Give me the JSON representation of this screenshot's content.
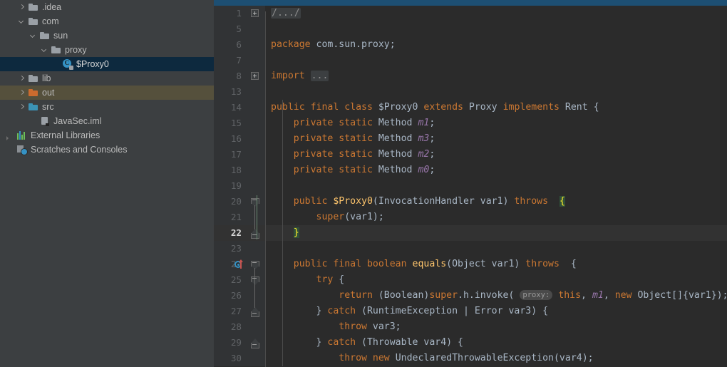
{
  "app": {
    "theme": "darcula",
    "accent_selection": "#0d293e",
    "excluded_bg": "#55503c",
    "topbar_color": "#1d4f73"
  },
  "sidebar": {
    "name": "Project tree",
    "items": [
      {
        "label": ".idea",
        "indent": 1,
        "twisty": "right",
        "icon": "folder-grey-icon",
        "state": "normal"
      },
      {
        "label": "com",
        "indent": 1,
        "twisty": "down",
        "icon": "folder-grey-icon",
        "state": "normal"
      },
      {
        "label": "sun",
        "indent": 2,
        "twisty": "down",
        "icon": "folder-grey-icon",
        "state": "normal"
      },
      {
        "label": "proxy",
        "indent": 3,
        "twisty": "down",
        "icon": "folder-grey-icon",
        "state": "normal"
      },
      {
        "label": "$Proxy0",
        "indent": 4,
        "twisty": "none",
        "icon": "java-class-icon",
        "state": "selected"
      },
      {
        "label": "lib",
        "indent": 1,
        "twisty": "right",
        "icon": "folder-grey-icon",
        "state": "normal"
      },
      {
        "label": "out",
        "indent": 1,
        "twisty": "right",
        "icon": "folder-orange-icon",
        "state": "excluded"
      },
      {
        "label": "src",
        "indent": 1,
        "twisty": "right",
        "icon": "folder-blue-icon",
        "state": "normal"
      },
      {
        "label": "JavaSec.iml",
        "indent": 2,
        "twisty": "none",
        "icon": "iml-file-icon",
        "state": "normal"
      },
      {
        "label": "External Libraries",
        "indent": 0,
        "twisty": "ext",
        "icon": "libraries-icon",
        "state": "normal"
      },
      {
        "label": "Scratches and Consoles",
        "indent": 0,
        "twisty": "none",
        "icon": "scratches-icon",
        "state": "normal"
      }
    ]
  },
  "editor": {
    "name": "code-editor",
    "current_line": 22,
    "lines": [
      {
        "num": "1",
        "fold": "plus-top",
        "rail": false,
        "tokens": [
          {
            "t": "/.../",
            "c": "fold"
          }
        ]
      },
      {
        "num": "5",
        "tokens": []
      },
      {
        "num": "6",
        "tokens": [
          {
            "t": "package ",
            "c": "kw"
          },
          {
            "t": "com.sun.proxy;",
            "c": "txt"
          }
        ]
      },
      {
        "num": "7",
        "tokens": []
      },
      {
        "num": "8",
        "fold": "plus",
        "tokens": [
          {
            "t": "import ",
            "c": "kw"
          },
          {
            "t": "...",
            "c": "fold"
          }
        ]
      },
      {
        "num": "13",
        "tokens": []
      },
      {
        "num": "14",
        "tokens": [
          {
            "t": "public final class ",
            "c": "kw"
          },
          {
            "t": "$Proxy0 ",
            "c": "txt"
          },
          {
            "t": "extends ",
            "c": "kw"
          },
          {
            "t": "Proxy ",
            "c": "txt"
          },
          {
            "t": "implements ",
            "c": "kw"
          },
          {
            "t": "Rent {",
            "c": "txt"
          }
        ]
      },
      {
        "num": "15",
        "tokens": [
          {
            "t": "    private static ",
            "c": "kw"
          },
          {
            "t": "Method ",
            "c": "txt"
          },
          {
            "t": "m1",
            "c": "fld"
          },
          {
            "t": ";",
            "c": "txt"
          }
        ]
      },
      {
        "num": "16",
        "tokens": [
          {
            "t": "    private static ",
            "c": "kw"
          },
          {
            "t": "Method ",
            "c": "txt"
          },
          {
            "t": "m3",
            "c": "fld"
          },
          {
            "t": ";",
            "c": "txt"
          }
        ]
      },
      {
        "num": "17",
        "tokens": [
          {
            "t": "    private static ",
            "c": "kw"
          },
          {
            "t": "Method ",
            "c": "txt"
          },
          {
            "t": "m2",
            "c": "fld"
          },
          {
            "t": ";",
            "c": "txt"
          }
        ]
      },
      {
        "num": "18",
        "tokens": [
          {
            "t": "    private static ",
            "c": "kw"
          },
          {
            "t": "Method ",
            "c": "txt"
          },
          {
            "t": "m0",
            "c": "fld"
          },
          {
            "t": ";",
            "c": "txt"
          }
        ]
      },
      {
        "num": "19",
        "tokens": []
      },
      {
        "num": "20",
        "fold": "arrow-down",
        "scope_start": true,
        "tokens": [
          {
            "t": "    public ",
            "c": "kw"
          },
          {
            "t": "$Proxy0",
            "c": "mth"
          },
          {
            "t": "(InvocationHandler var1) ",
            "c": "txt"
          },
          {
            "t": "throws",
            "c": "kw"
          },
          {
            "t": "  ",
            "c": "txt"
          },
          {
            "t": "{",
            "c": "brace-hl"
          }
        ]
      },
      {
        "num": "21",
        "tokens": [
          {
            "t": "        ",
            "c": "txt"
          },
          {
            "t": "super",
            "c": "kw"
          },
          {
            "t": "(var1);",
            "c": "txt"
          }
        ]
      },
      {
        "num": "22",
        "fold": "arrow-up",
        "current": true,
        "scope_end": true,
        "tokens": [
          {
            "t": "    ",
            "c": "txt"
          },
          {
            "t": "}",
            "c": "brace-hl"
          }
        ]
      },
      {
        "num": "23",
        "tokens": []
      },
      {
        "num": "24",
        "fold": "arrow-down",
        "impl_icon": true,
        "tokens": [
          {
            "t": "    public final boolean ",
            "c": "kw"
          },
          {
            "t": "equals",
            "c": "mth"
          },
          {
            "t": "(Object var1) ",
            "c": "txt"
          },
          {
            "t": "throws",
            "c": "kw"
          },
          {
            "t": "  {",
            "c": "txt"
          }
        ]
      },
      {
        "num": "25",
        "fold": "arrow-down",
        "tokens": [
          {
            "t": "        ",
            "c": "txt"
          },
          {
            "t": "try",
            "c": "kw"
          },
          {
            "t": " {",
            "c": "txt"
          }
        ]
      },
      {
        "num": "26",
        "tokens": [
          {
            "t": "            ",
            "c": "txt"
          },
          {
            "t": "return",
            "c": "kw"
          },
          {
            "t": " (Boolean)",
            "c": "txt"
          },
          {
            "t": "super",
            "c": "kw"
          },
          {
            "t": ".h.invoke(",
            "c": "txt"
          },
          {
            "t": " ",
            "c": "txt"
          },
          {
            "t": "proxy:",
            "c": "hint"
          },
          {
            "t": " ",
            "c": "txt"
          },
          {
            "t": "this",
            "c": "kw"
          },
          {
            "t": ", ",
            "c": "txt"
          },
          {
            "t": "m1",
            "c": "fld"
          },
          {
            "t": ", ",
            "c": "txt"
          },
          {
            "t": "new",
            "c": "kw"
          },
          {
            "t": " Object[]{var1});",
            "c": "txt"
          }
        ]
      },
      {
        "num": "27",
        "fold": "arrow-up",
        "tokens": [
          {
            "t": "        } ",
            "c": "txt"
          },
          {
            "t": "catch",
            "c": "kw"
          },
          {
            "t": " (RuntimeException | Error var3) {",
            "c": "txt"
          }
        ]
      },
      {
        "num": "28",
        "tokens": [
          {
            "t": "            ",
            "c": "txt"
          },
          {
            "t": "throw",
            "c": "kw"
          },
          {
            "t": " var3;",
            "c": "txt"
          }
        ]
      },
      {
        "num": "29",
        "fold": "arrow-up",
        "tokens": [
          {
            "t": "        } ",
            "c": "txt"
          },
          {
            "t": "catch",
            "c": "kw"
          },
          {
            "t": " (Throwable var4) {",
            "c": "txt"
          }
        ]
      },
      {
        "num": "30",
        "tokens": [
          {
            "t": "            ",
            "c": "txt"
          },
          {
            "t": "throw new",
            "c": "kw"
          },
          {
            "t": " UndeclaredThrowableException(var4);",
            "c": "txt"
          }
        ]
      }
    ]
  }
}
